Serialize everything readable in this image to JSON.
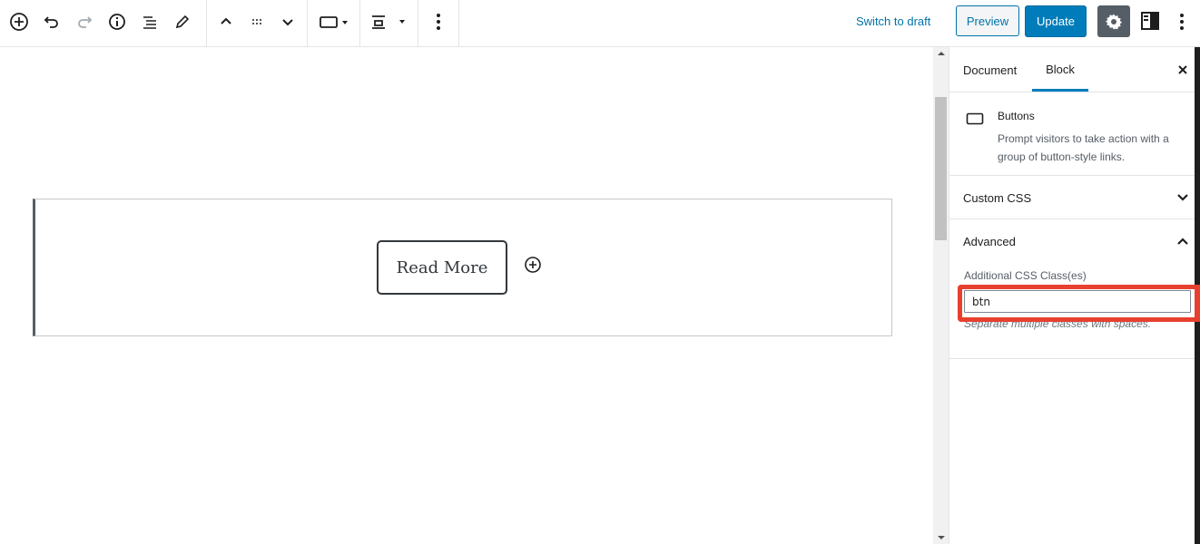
{
  "toolbar": {
    "switch_to_draft": "Switch to draft",
    "preview": "Preview",
    "update": "Update"
  },
  "canvas": {
    "button_text": "Read More"
  },
  "sidebar": {
    "tabs": [
      {
        "label": "Document",
        "active": false
      },
      {
        "label": "Block",
        "active": true
      }
    ],
    "block": {
      "title": "Buttons",
      "description": "Prompt visitors to take action with a group of button-style links."
    },
    "panels": {
      "custom_css": {
        "title": "Custom CSS",
        "expanded": false
      },
      "advanced": {
        "title": "Advanced",
        "expanded": true,
        "field_label": "Additional CSS Class(es)",
        "field_value": "btn",
        "help": "Separate multiple classes with spaces."
      }
    }
  },
  "colors": {
    "accent": "#007cba",
    "highlight": "#e8402f"
  }
}
